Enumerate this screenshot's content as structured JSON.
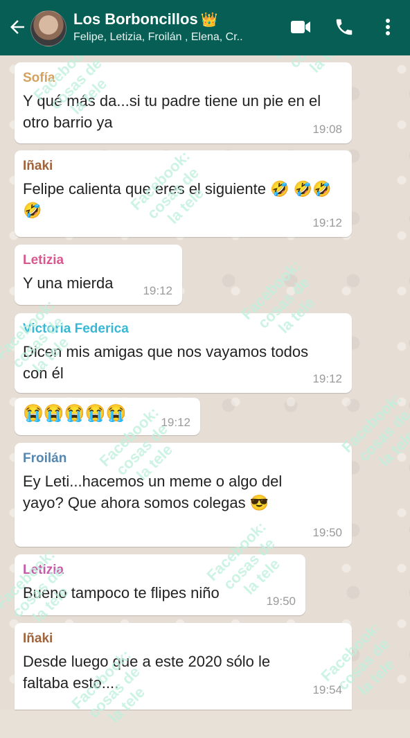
{
  "header": {
    "title": "Los Borboncillos",
    "title_emoji": "👑",
    "members": "Felipe, Letizia, Froilán , Elena, Cr..",
    "back_icon": "arrow-left-icon",
    "video_icon": "video-call-icon",
    "call_icon": "phone-icon",
    "more_icon": "more-vertical-icon",
    "bar_color": "#075e54"
  },
  "messages": [
    {
      "sender": "Sofía",
      "sender_color": "#d4a15f",
      "text": "Y qué más da...si tu padre tiene un pie en el otro barrio ya",
      "time": "19:08"
    },
    {
      "sender": "Iñaki",
      "sender_color": "#a0643d",
      "text": "Felipe calienta que eres el siguiente 🤣 🤣🤣🤣",
      "time": "19:12"
    },
    {
      "sender": "Letizia",
      "sender_color": "#d9578f",
      "text": "Y una mierda",
      "time": "19:12"
    },
    {
      "sender": "Victoria Federica",
      "sender_color": "#38b8d5",
      "text": "Dicen mis amigas que nos vayamos todos con él",
      "time": "19:12"
    },
    {
      "sender": "",
      "sender_color": "",
      "text": "😭😭😭😭😭",
      "time": "19:12"
    },
    {
      "sender": "Froilán",
      "sender_color": "#5586b0",
      "text": "Ey Leti...hacemos un meme o algo del yayo? Que ahora somos colegas 😎",
      "time": "19:50"
    },
    {
      "sender": "Letizia",
      "sender_color": "#c55aa8",
      "text": "Bueno tampoco te flipes niño",
      "time": "19:50"
    },
    {
      "sender": "Iñaki",
      "sender_color": "#a0643d",
      "text": "Desde luego que a este 2020 sólo le faltaba esto....",
      "time": "19:54"
    }
  ],
  "watermark": {
    "line1": "Facebook:",
    "line2": "cosas de",
    "line3": "la tele",
    "color": "#bdf0dc"
  }
}
